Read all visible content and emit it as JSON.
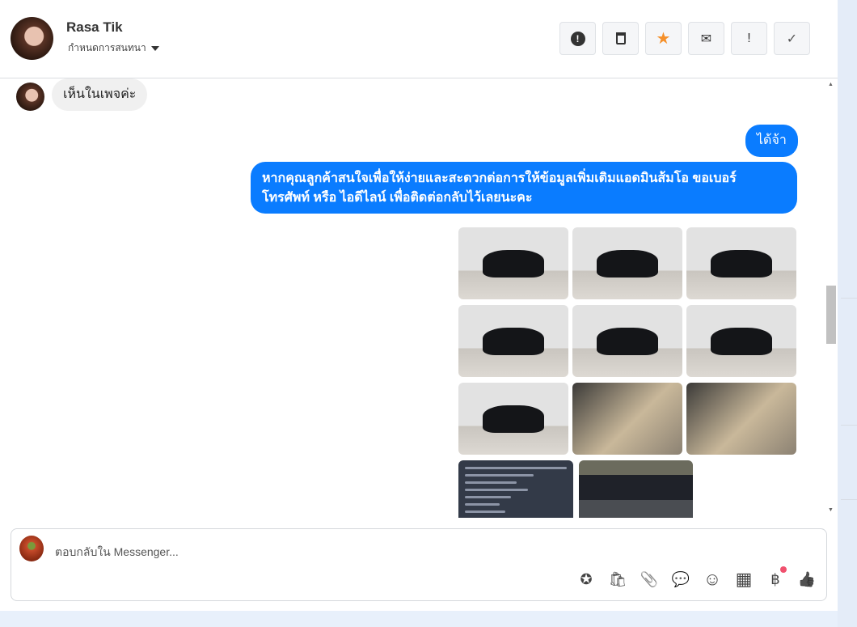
{
  "header": {
    "name": "Rasa Tik",
    "subtitle": "กำหนดการสนทนา",
    "actions": [
      {
        "name": "spam",
        "glyph": "❗"
      },
      {
        "name": "delete",
        "glyph": "🗑"
      },
      {
        "name": "star",
        "glyph": "★"
      },
      {
        "name": "mail",
        "glyph": "✉"
      },
      {
        "name": "important",
        "glyph": "!"
      },
      {
        "name": "done",
        "glyph": "✓"
      }
    ]
  },
  "messages": {
    "incoming": "เห็นในเพจค่ะ",
    "outgoing_short": "ได้จ้า",
    "outgoing_long_1": "หากคุณลูกค้าสนใจเพื่อให้ง่ายและสะดวกต่อการให้ข้อมูลเพิ่มเติมแอดมินส้มโอ ขอเบอร์",
    "outgoing_long_2": "โทรศัพท์ หรือ ไอดีไลน์ เพื่อติดต่อกลับไว้เลยนะคะ"
  },
  "composer": {
    "placeholder": "ตอบกลับใน Messenger...",
    "tools": [
      {
        "name": "saved-reply",
        "glyph": "✪"
      },
      {
        "name": "shop",
        "glyph": "🛍"
      },
      {
        "name": "attach",
        "glyph": "📎"
      },
      {
        "name": "quick-reply",
        "glyph": "💬"
      },
      {
        "name": "emoji",
        "glyph": "☺"
      },
      {
        "name": "table",
        "glyph": "▦"
      },
      {
        "name": "baht",
        "glyph": "฿"
      },
      {
        "name": "like",
        "glyph": "👍"
      }
    ]
  }
}
